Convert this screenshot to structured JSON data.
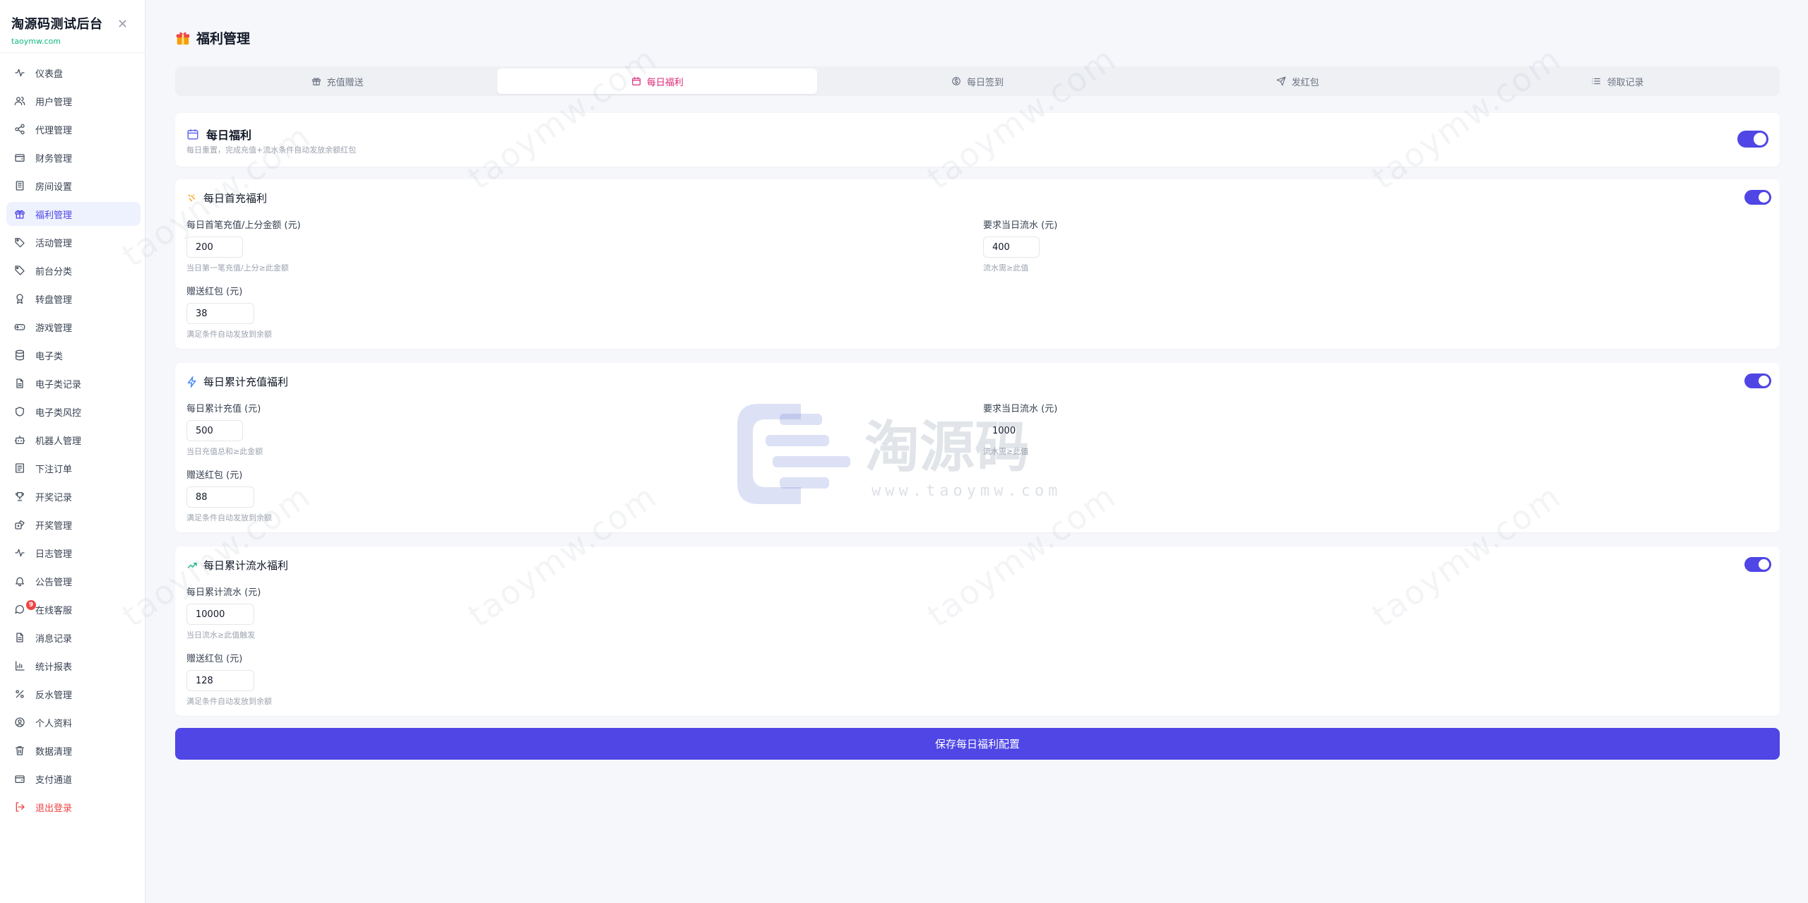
{
  "brand": {
    "title": "淘源码测试后台",
    "subtitle": "taoymw.com"
  },
  "sidebar": {
    "items": [
      {
        "label": "仪表盘",
        "icon": "activity-icon"
      },
      {
        "label": "用户管理",
        "icon": "users-icon"
      },
      {
        "label": "代理管理",
        "icon": "share-icon"
      },
      {
        "label": "财务管理",
        "icon": "wallet-icon"
      },
      {
        "label": "房间设置",
        "icon": "building-icon"
      },
      {
        "label": "福利管理",
        "icon": "gift-icon",
        "active": true
      },
      {
        "label": "活动管理",
        "icon": "tag-icon"
      },
      {
        "label": "前台分类",
        "icon": "tags-icon"
      },
      {
        "label": "转盘管理",
        "icon": "award-icon"
      },
      {
        "label": "游戏管理",
        "icon": "gamepad-icon"
      },
      {
        "label": "电子类",
        "icon": "database-icon"
      },
      {
        "label": "电子类记录",
        "icon": "file-icon"
      },
      {
        "label": "电子类风控",
        "icon": "shield-icon"
      },
      {
        "label": "机器人管理",
        "icon": "bot-icon"
      },
      {
        "label": "下注订单",
        "icon": "receipt-icon"
      },
      {
        "label": "开奖记录",
        "icon": "trophy-icon"
      },
      {
        "label": "开奖管理",
        "icon": "dice-icon"
      },
      {
        "label": "日志管理",
        "icon": "activity-icon"
      },
      {
        "label": "公告管理",
        "icon": "bell-icon"
      },
      {
        "label": "在线客服",
        "icon": "message-icon",
        "badge": "9"
      },
      {
        "label": "消息记录",
        "icon": "file-text-icon"
      },
      {
        "label": "统计报表",
        "icon": "bar-chart-icon"
      },
      {
        "label": "反水管理",
        "icon": "percent-icon"
      },
      {
        "label": "个人资料",
        "icon": "user-circle-icon"
      },
      {
        "label": "数据清理",
        "icon": "trash-icon"
      },
      {
        "label": "支付通道",
        "icon": "wallet-icon"
      },
      {
        "label": "退出登录",
        "icon": "logout-icon",
        "danger": true
      }
    ]
  },
  "page": {
    "title": "福利管理"
  },
  "tabs": [
    {
      "label": "充值赠送",
      "icon": "gift-icon"
    },
    {
      "label": "每日福利",
      "icon": "calendar-icon",
      "active": true
    },
    {
      "label": "每日签到",
      "icon": "coin-icon"
    },
    {
      "label": "发红包",
      "icon": "send-icon"
    },
    {
      "label": "领取记录",
      "icon": "list-icon"
    }
  ],
  "daily": {
    "title": "每日福利",
    "desc": "每日重置，完成充值+流水条件自动发放余额红包",
    "enabled": true
  },
  "first_recharge": {
    "title": "每日首充福利",
    "enabled": true,
    "amount": {
      "label": "每日首笔充值/上分金额 (元)",
      "value": "200",
      "hint": "当日第一笔充值/上分≥此金额"
    },
    "turnover": {
      "label": "要求当日流水 (元)",
      "value": "400",
      "hint": "流水需≥此值"
    },
    "bonus": {
      "label": "赠送红包 (元)",
      "value": "38",
      "hint": "满足条件自动发放到余额"
    }
  },
  "cumulative_recharge": {
    "title": "每日累计充值福利",
    "enabled": true,
    "amount": {
      "label": "每日累计充值 (元)",
      "value": "500",
      "hint": "当日充值总和≥此金额"
    },
    "turnover": {
      "label": "要求当日流水 (元)",
      "value": "1000",
      "hint": "流水需≥此值"
    },
    "bonus": {
      "label": "赠送红包 (元)",
      "value": "88",
      "hint": "满足条件自动发放到余额"
    }
  },
  "cumulative_turnover": {
    "title": "每日累计流水福利",
    "enabled": true,
    "amount": {
      "label": "每日累计流水 (元)",
      "value": "10000",
      "hint": "当日流水≥此值触发"
    },
    "bonus": {
      "label": "赠送红包 (元)",
      "value": "128",
      "hint": "满足条件自动发放到余额"
    }
  },
  "save_button": "保存每日福利配置",
  "watermark": {
    "text": "taoymw.com",
    "logo_text": "淘源码",
    "logo_url": "www.taoymw.com"
  },
  "colors": {
    "accent": "#4f46e5",
    "active_tab": "#db2777",
    "danger": "#ef4444",
    "brand_sub": "#10b981"
  }
}
